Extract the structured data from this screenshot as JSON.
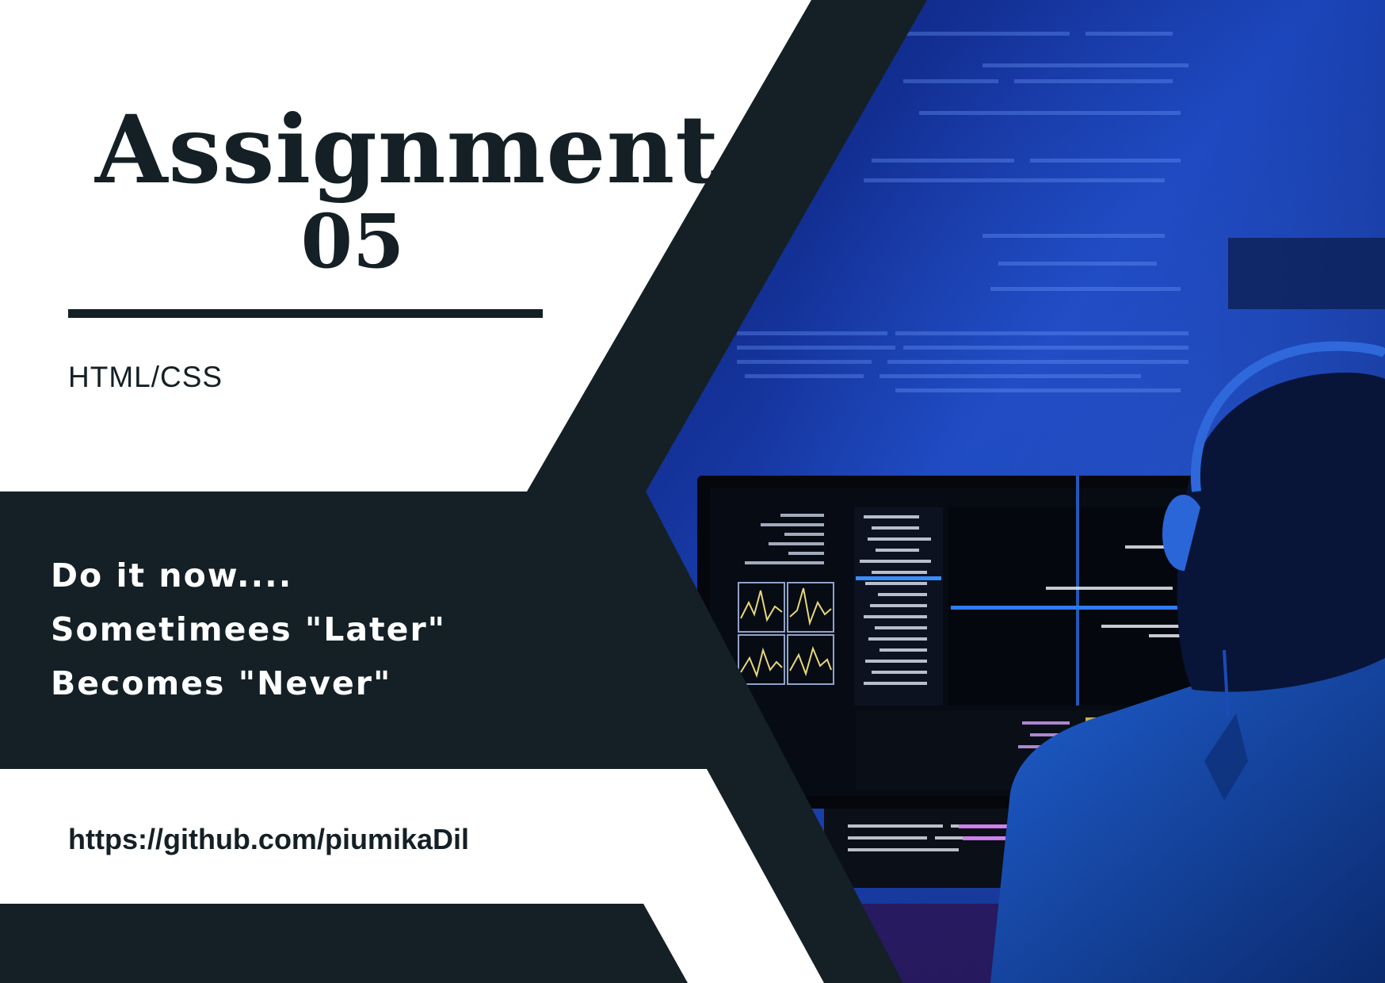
{
  "title": {
    "line1": "Assignment",
    "line2": "05"
  },
  "subtitle": "HTML/CSS",
  "quote": [
    "Do it now....",
    "Sometimees \"Later\"",
    "Becomes \"Never\""
  ],
  "link": "https://github.com/piumikaDil",
  "photo": {
    "subject": "developer-with-headphones-at-computer-illustration"
  },
  "colors": {
    "dark": "#142025",
    "white": "#ffffff",
    "blue": "#1a3fa8"
  }
}
